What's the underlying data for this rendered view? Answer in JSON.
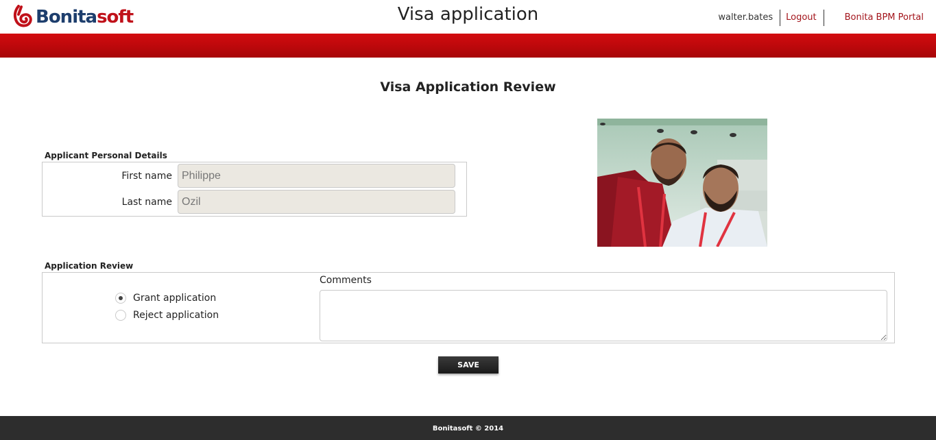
{
  "header": {
    "logo_text_main": "Bonita",
    "logo_text_accent": "soft",
    "app_title": "Visa application",
    "username": "walter.bates",
    "logout_label": "Logout",
    "portal_label": "Bonita BPM Portal"
  },
  "colors": {
    "brand_red": "#c0111a",
    "brand_blue": "#1d3e6d",
    "band_red": "#c8080c",
    "footer_bg": "#2d2d2d"
  },
  "form": {
    "title": "Visa Application Review",
    "personal_section": {
      "label": "Applicant Personal Details",
      "first_name_label": "First name",
      "first_name_value": "Philippe",
      "last_name_label": "Last name",
      "last_name_value": "Ozil"
    },
    "review_section": {
      "label": "Application Review",
      "options": [
        {
          "label": "Grant application",
          "checked": true
        },
        {
          "label": "Reject application",
          "checked": false
        }
      ],
      "comments_label": "Comments",
      "comments_value": ""
    },
    "save_label": "SAVE"
  },
  "footer": {
    "text": "Bonitasoft © 2014"
  }
}
